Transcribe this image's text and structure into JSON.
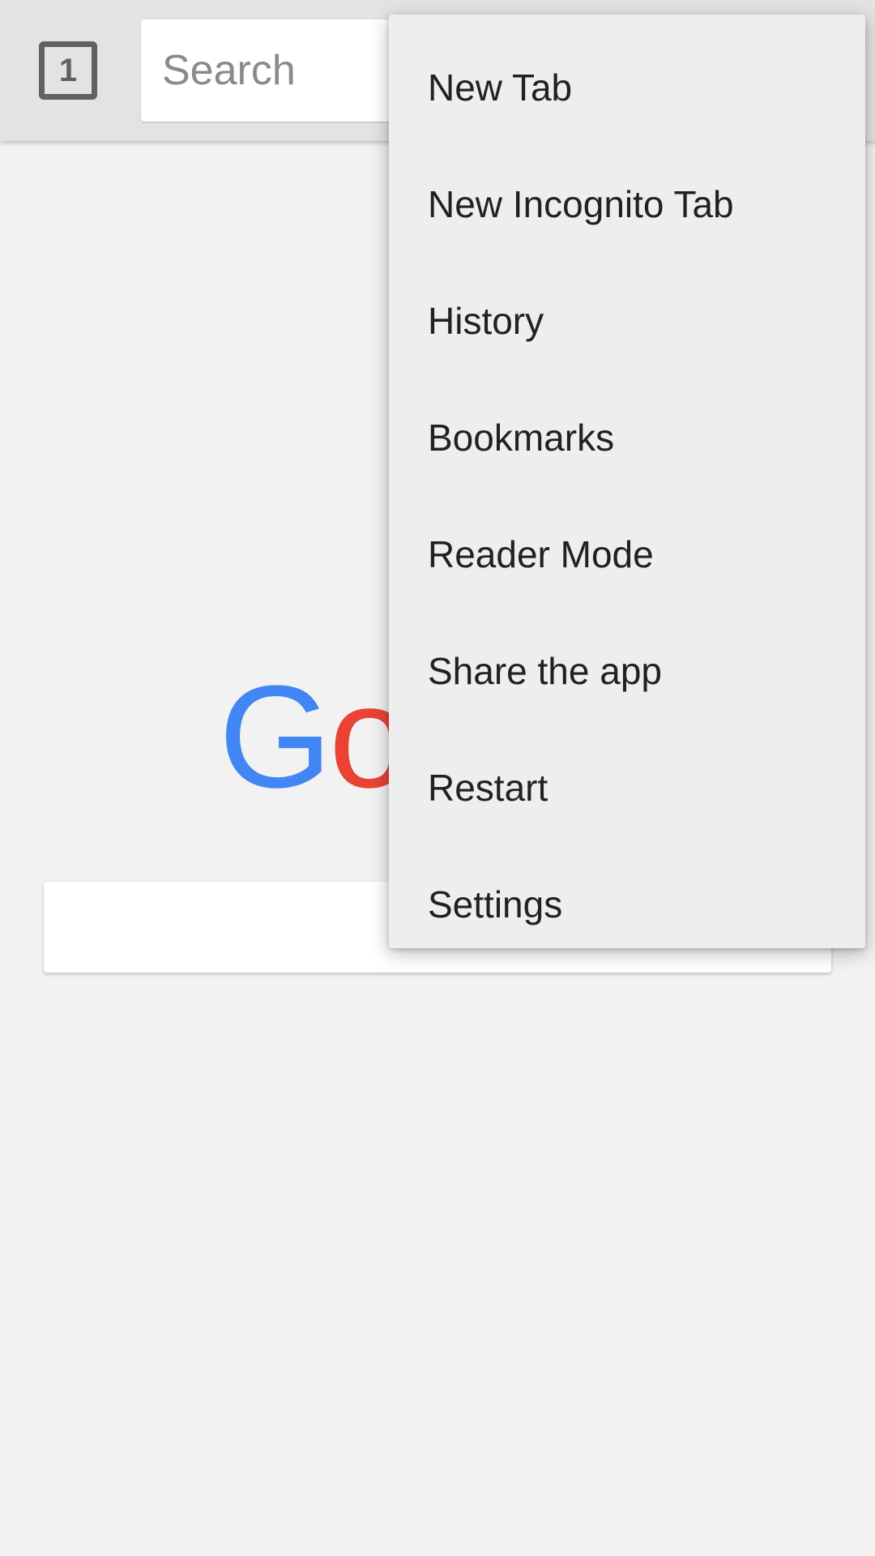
{
  "toolbar": {
    "tab_count": "1",
    "search_placeholder": "Search"
  },
  "logo": {
    "letters": [
      {
        "char": "G",
        "color": "#4285f4"
      },
      {
        "char": "o",
        "color": "#ea4335"
      }
    ]
  },
  "menu": {
    "items": [
      {
        "label": "New Tab"
      },
      {
        "label": "New Incognito Tab"
      },
      {
        "label": "History"
      },
      {
        "label": "Bookmarks"
      },
      {
        "label": "Reader Mode"
      },
      {
        "label": "Share the app"
      },
      {
        "label": "Restart"
      },
      {
        "label": "Settings"
      }
    ]
  }
}
